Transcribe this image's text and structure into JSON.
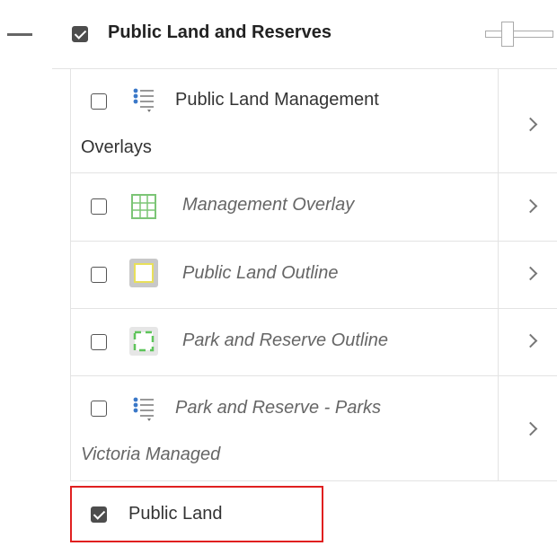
{
  "group": {
    "title": "Public Land and Reserves",
    "checked": true,
    "collapse_icon": "minus-icon",
    "opacity_icon": "opacity-slider-icon"
  },
  "layers": [
    {
      "label_line1": "Public Land Management",
      "label_line2": "Overlays",
      "checked": false,
      "icon": "legend-list-icon",
      "italic": false
    },
    {
      "label_line1": "Management Overlay",
      "checked": false,
      "icon": "grid-fill-icon",
      "italic": true
    },
    {
      "label_line1": "Public Land Outline",
      "checked": false,
      "icon": "yellow-outline-icon",
      "italic": true
    },
    {
      "label_line1": "Park and Reserve Outline",
      "checked": false,
      "icon": "green-dashed-outline-icon",
      "italic": true
    },
    {
      "label_line1": "Park and Reserve - Parks",
      "label_line2": "Victoria Managed",
      "checked": false,
      "icon": "legend-list-icon",
      "italic": true
    }
  ],
  "bottom_item": {
    "label": "Public Land",
    "checked": true
  },
  "colors": {
    "grid_green": "#7cc576",
    "outline_yellow": "#e8e05a",
    "outline_green": "#5ec45a",
    "highlight_red": "#e02020",
    "list_blue": "#3a78c8"
  }
}
